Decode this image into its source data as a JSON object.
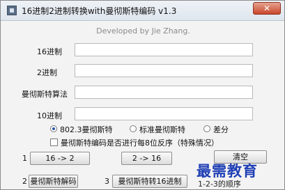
{
  "window": {
    "title": "16进制2进制转换with曼彻斯特编码 v1.3",
    "close_glyph": "✕"
  },
  "header": {
    "subtitle": "Developed by Jie Zhang."
  },
  "fields": [
    {
      "label": "16进制",
      "value": ""
    },
    {
      "label": "2进制",
      "value": ""
    },
    {
      "label": "曼彻斯特算法",
      "value": ""
    },
    {
      "label": "10进制",
      "value": ""
    }
  ],
  "radios": [
    {
      "label": "802.3曼彻斯特",
      "checked": true
    },
    {
      "label": "标准曼彻斯特",
      "checked": false
    },
    {
      "label": "差分",
      "checked": false
    }
  ],
  "checkbox": {
    "label": "曼彻斯特编码是否进行每8位反序（特殊情况）",
    "checked": false
  },
  "buttons": {
    "num1": "1",
    "hex_to_bin": "16 -> 2",
    "bin_to_hex": "2 -> 16",
    "clear": "清空",
    "num2": "2",
    "manchester_decode": "曼彻斯特解码",
    "num3": "3",
    "manchester_to_hex": "曼彻斯特转16进制"
  },
  "notes": {
    "order_hint": "1-2-3的顺序"
  },
  "watermark": {
    "text": "最需教育"
  },
  "colors": {
    "watermark": "#1f3fb4",
    "close": "#c9452b"
  }
}
